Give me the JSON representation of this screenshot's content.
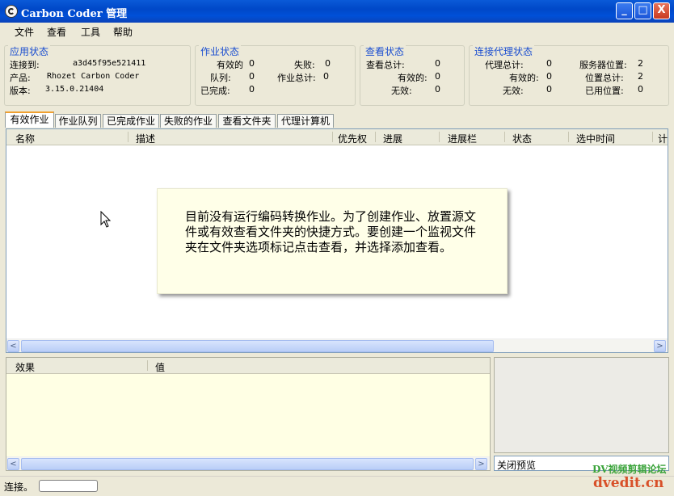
{
  "window": {
    "title": "Carbon Coder 管理",
    "min_label": "_",
    "max_label": "□",
    "close_label": "X"
  },
  "menu": [
    "文件",
    "查看",
    "工具",
    "帮助"
  ],
  "app_status": {
    "title": "应用状态",
    "connected_label": "连接到:",
    "connected_value": "a3d45f95e521411",
    "product_label": "产品:",
    "product_value": "Rhozet Carbon Coder",
    "version_label": "版本:",
    "version_value": "3.15.0.21404"
  },
  "job_status": {
    "title": "作业状态",
    "valid_label": "有效的",
    "valid_value": "0",
    "failed_label": "失败:",
    "failed_value": "0",
    "queue_label": "队列:",
    "queue_value": "0",
    "total_label": "作业总计:",
    "total_value": "0",
    "done_label": "已完成:",
    "done_value": "0"
  },
  "watch_status": {
    "title": "查看状态",
    "total_label": "查看总计:",
    "total_value": "0",
    "valid_label": "有效的:",
    "valid_value": "0",
    "invalid_label": "无效:",
    "invalid_value": "0"
  },
  "proxy_status": {
    "title": "连接代理状态",
    "total_label": "代理总计:",
    "total_value": "0",
    "valid_label": "有效的:",
    "valid_value": "0",
    "invalid_label": "无效:",
    "invalid_value": "0",
    "server_pos_label": "服务器位置:",
    "server_pos_value": "2",
    "pos_total_label": "位置总计:",
    "pos_total_value": "2",
    "used_pos_label": "已用位置:",
    "used_pos_value": "0"
  },
  "tabs": [
    "有效作业",
    "作业队列",
    "已完成作业",
    "失败的作业",
    "查看文件夹",
    "代理计算机"
  ],
  "columns": [
    "名称",
    "描述",
    "优先权",
    "进展",
    "进展栏",
    "状态",
    "选中时间",
    "计"
  ],
  "empty_message": "目前没有运行编码转换作业。为了创建作业、放置源文件或有效查看文件夹的快捷方式。要创建一个监视文件夹在文件夹选项标记点击查看，并选择添加查看。",
  "effects_columns": [
    "效果",
    "值"
  ],
  "close_preview_label": "关闭预览",
  "status_text": "连接。",
  "watermark_line1": "DV视频剪辑论坛",
  "watermark_line2": "dvedit.cn",
  "scroll_arrows": {
    "left": "<",
    "right": ">"
  },
  "scroll_grip": "|||"
}
